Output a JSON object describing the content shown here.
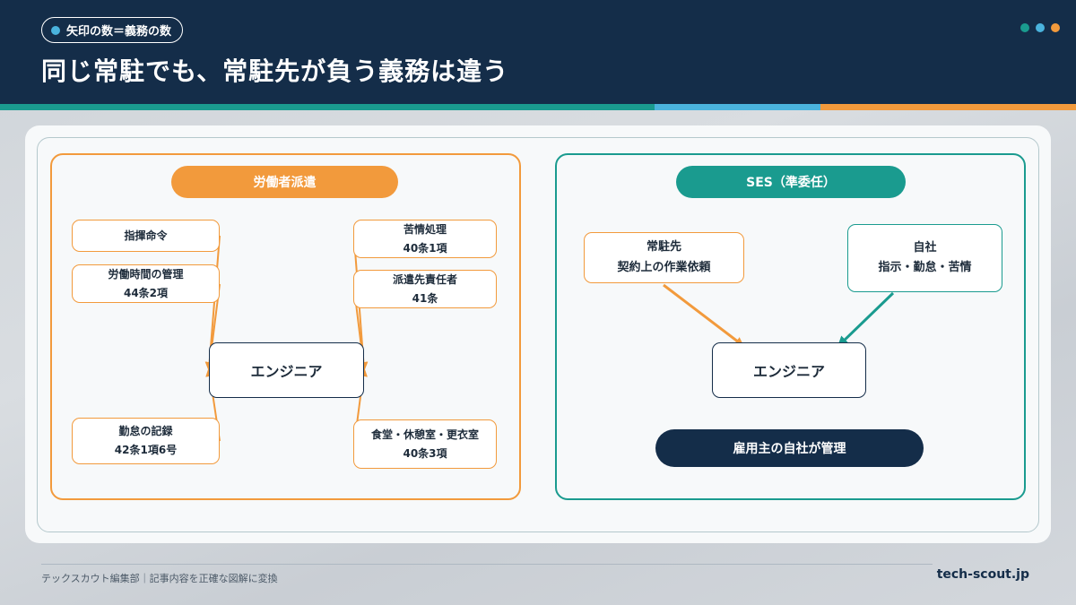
{
  "header": {
    "tag": "矢印の数＝義務の数",
    "title": "同じ常駐でも、常駐先が負う義務は違う"
  },
  "colors": {
    "navy": "#142d49",
    "orange": "#f29a3c",
    "teal": "#1a9b8f",
    "blue": "#4ab3dd"
  },
  "left_panel": {
    "title": "労働者派遣",
    "center": "エンジニア",
    "boxes": [
      {
        "l1": "指揮命令",
        "l2": ""
      },
      {
        "l1": "労働時間の管理",
        "l2": "44条2項"
      },
      {
        "l1": "勤怠の記録",
        "l2": "42条1項6号"
      },
      {
        "l1": "苦情処理",
        "l2": "40条1項"
      },
      {
        "l1": "派遣先責任者",
        "l2": "41条"
      },
      {
        "l1": "食堂・休憩室・更衣室",
        "l2": "40条3項"
      }
    ]
  },
  "right_panel": {
    "title": "SES（準委任）",
    "center": "エンジニア",
    "client": {
      "l1": "常駐先",
      "l2": "契約上の作業依頼"
    },
    "own": {
      "l1": "自社",
      "l2": "指示・勤怠・苦情"
    },
    "note": "雇用主の自社が管理"
  },
  "footer": {
    "left": "テックスカウト編集部｜記事内容を正確な図解に変換",
    "right": "tech-scout.jp"
  }
}
